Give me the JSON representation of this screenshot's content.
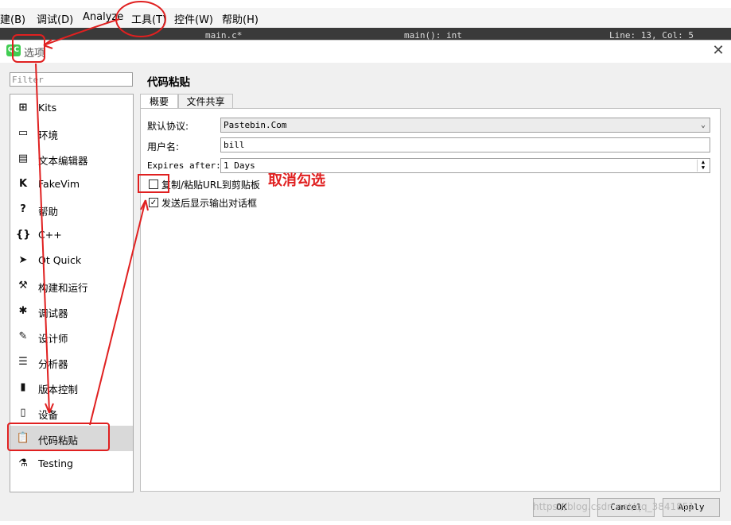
{
  "menubar": {
    "items": [
      "构建(B)",
      "调试(D)",
      "Analyze",
      "工具(T)",
      "控件(W)",
      "帮助(H)"
    ],
    "partial_first": "建(B)"
  },
  "editorbar": {
    "file": "main.c*",
    "function": "main(): int",
    "position": "Line: 13, Col: 5"
  },
  "dialog": {
    "title": "选项",
    "app_icon": "QC",
    "close_icon": "close-icon",
    "filter_placeholder": "Filter",
    "categories": [
      {
        "label": "Kits",
        "icon": "kits-icon",
        "glyph": "⊞"
      },
      {
        "label": "环境",
        "icon": "monitor-icon",
        "glyph": "▭"
      },
      {
        "label": "文本编辑器",
        "icon": "text-editor-icon",
        "glyph": "▤"
      },
      {
        "label": "FakeVim",
        "icon": "fakevim-icon",
        "glyph": "K"
      },
      {
        "label": "帮助",
        "icon": "help-icon",
        "glyph": "?"
      },
      {
        "label": "C++",
        "icon": "braces-icon",
        "glyph": "{}"
      },
      {
        "label": "Qt Quick",
        "icon": "qtquick-icon",
        "glyph": "➤"
      },
      {
        "label": "构建和运行",
        "icon": "hammer-icon",
        "glyph": "⚒"
      },
      {
        "label": "调试器",
        "icon": "bug-icon",
        "glyph": "✱"
      },
      {
        "label": "设计师",
        "icon": "pencil-icon",
        "glyph": "✎"
      },
      {
        "label": "分析器",
        "icon": "analyzer-icon",
        "glyph": "☰"
      },
      {
        "label": "版本控制",
        "icon": "vcs-icon",
        "glyph": "▮"
      },
      {
        "label": "设备",
        "icon": "device-icon",
        "glyph": "▯"
      },
      {
        "label": "代码粘贴",
        "icon": "clipboard-icon",
        "glyph": "📋"
      },
      {
        "label": "Testing",
        "icon": "flask-icon",
        "glyph": "⚗"
      }
    ],
    "selected_category": "代码粘贴",
    "page_title": "代码粘贴",
    "tabs": [
      {
        "label": "概要",
        "active": true
      },
      {
        "label": "文件共享",
        "active": false
      }
    ],
    "form": {
      "protocol_label": "默认协议:",
      "protocol_value": "Pastebin.Com",
      "username_label": "用户名:",
      "username_value": "bill",
      "expires_label": "Expires after:",
      "expires_value": "1 Days",
      "copy_url_label": "复制/粘贴URL到剪贴板",
      "copy_url_checked": false,
      "show_output_label": "发送后显示输出对话框",
      "show_output_checked": true
    },
    "buttons": {
      "ok": "OK",
      "cancel": "Cancel",
      "apply": "Apply"
    }
  },
  "annotation": {
    "note": "取消勾选",
    "color": "#e02020"
  },
  "watermark": "https://blog.csdn.net/qq_3841851"
}
